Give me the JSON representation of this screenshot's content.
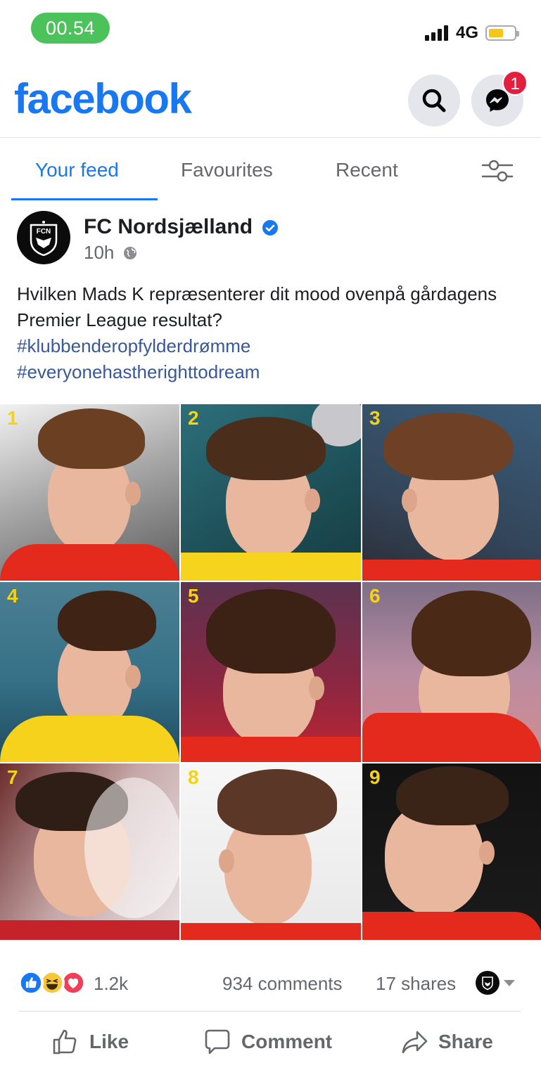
{
  "status_bar": {
    "time": "00.54",
    "network": "4G",
    "colors": {
      "time_pill": "#4cc25a",
      "battery": "#f5c518"
    }
  },
  "header": {
    "logo_text": "facebook",
    "search_icon": "search-icon",
    "messenger_icon": "messenger-icon",
    "messenger_badge": "1",
    "colors": {
      "brand": "#1877f2",
      "badge": "#e41e3f"
    }
  },
  "tabs": {
    "items": [
      {
        "label": "Your feed",
        "active": true
      },
      {
        "label": "Favourites",
        "active": false
      },
      {
        "label": "Recent",
        "active": false
      }
    ],
    "filter_icon": "filter-sliders-icon"
  },
  "post": {
    "author": "FC Nordsjælland",
    "verified": true,
    "time": "10h",
    "privacy_icon": "globe-icon",
    "text": "Hvilken Mads K repræsenterer dit mood ovenpå gårdagens Premier League resultat?",
    "hashtags": [
      "#klubbenderopfylderdrømme",
      "#everyonehastherighttodream"
    ],
    "photo_numbers": [
      "1",
      "2",
      "3",
      "4",
      "5",
      "6",
      "7",
      "8",
      "9"
    ]
  },
  "engagement": {
    "reaction_icons": [
      "like-reaction-icon",
      "haha-reaction-icon",
      "love-reaction-icon"
    ],
    "reaction_count": "1.2k",
    "comments": "934 comments",
    "shares": "17 shares"
  },
  "actions": {
    "like": "Like",
    "comment": "Comment",
    "share": "Share"
  }
}
